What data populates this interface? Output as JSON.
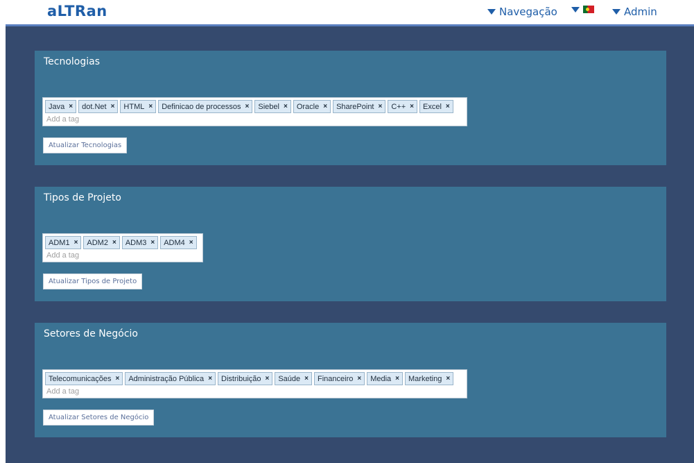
{
  "header": {
    "logo": "aLTRan",
    "nav_label": "Navegação",
    "admin_label": "Admin"
  },
  "colors": {
    "background": "#354a6e",
    "panel": "#3b7394",
    "brand": "#1f5ea8",
    "tag_bg": "#dbe9f5"
  },
  "sections": [
    {
      "title": "Tecnologias",
      "tags": [
        "Java",
        "dot.Net",
        "HTML",
        "Definicao de processos",
        "Siebel",
        "Oracle",
        "SharePoint",
        "C++",
        "Excel"
      ],
      "input_placeholder": "Add a tag",
      "button_label": "Atualizar Tecnologias"
    },
    {
      "title": "Tipos de Projeto",
      "tags": [
        "ADM1",
        "ADM2",
        "ADM3",
        "ADM4"
      ],
      "input_placeholder": "Add a tag",
      "button_label": "Atualizar Tipos de Projeto"
    },
    {
      "title": "Setores de Negócio",
      "tags": [
        "Telecomunicações",
        "Administração Pública",
        "Distribuição",
        "Saúde",
        "Financeiro",
        "Media",
        "Marketing"
      ],
      "input_placeholder": "Add a tag",
      "button_label": "Atualizar Setores de Negócio"
    }
  ]
}
